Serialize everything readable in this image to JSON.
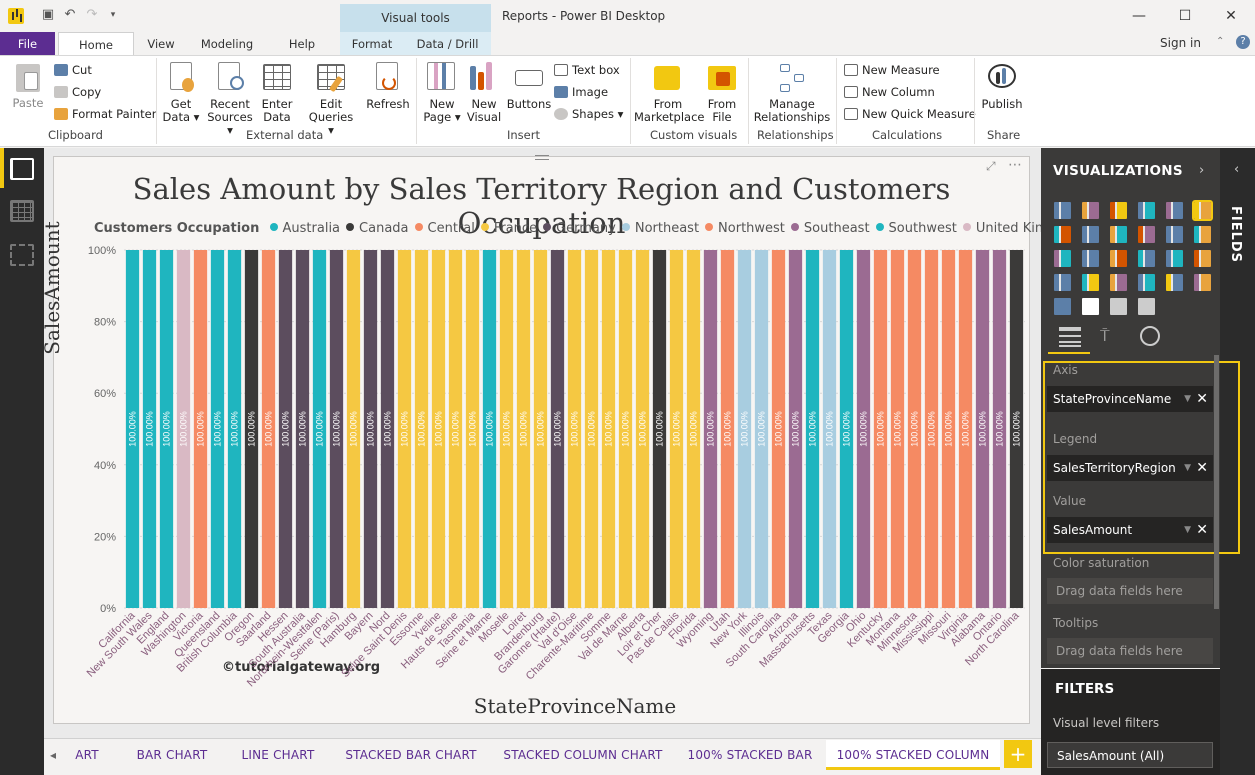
{
  "window": {
    "title": "Reports - Power BI Desktop",
    "context_tab": "Visual tools",
    "sign_in": "Sign in",
    "minimize": "—",
    "maximize": "☐",
    "close": "✕"
  },
  "ribbon_tabs": [
    "File",
    "Home",
    "View",
    "Modeling",
    "Help",
    "Format",
    "Data / Drill"
  ],
  "ribbon": {
    "clipboard": {
      "paste": "Paste",
      "cut": "Cut",
      "copy": "Copy",
      "format_painter": "Format Painter",
      "group": "Clipboard"
    },
    "external": {
      "get_data": [
        "Get",
        "Data ▾"
      ],
      "recent_sources": [
        "Recent",
        "Sources ▾"
      ],
      "enter_data": [
        "Enter",
        "Data"
      ],
      "edit_queries": [
        "Edit",
        "Queries ▾"
      ],
      "refresh": "Refresh",
      "group": "External data"
    },
    "insert": {
      "new_page": [
        "New",
        "Page ▾"
      ],
      "new_visual": [
        "New",
        "Visual"
      ],
      "buttons": "Buttons",
      "text_box": "Text box",
      "image": "Image",
      "shapes": "Shapes ▾",
      "group": "Insert"
    },
    "custom": {
      "marketplace": [
        "From",
        "Marketplace"
      ],
      "file": [
        "From",
        "File"
      ],
      "group": "Custom visuals"
    },
    "relationships": {
      "manage": [
        "Manage",
        "Relationships"
      ],
      "group": "Relationships"
    },
    "calculations": {
      "new_measure": "New Measure",
      "new_column": "New Column",
      "new_quick_measure": "New Quick Measure",
      "group": "Calculations"
    },
    "share": {
      "publish": "Publish",
      "group": "Share"
    }
  },
  "visual": {
    "title": "Sales Amount by Sales Territory Region and Customers Occupation",
    "legend_title": "Customers Occupation",
    "legend": [
      {
        "name": "Australia",
        "color": "#1fb5bf"
      },
      {
        "name": "Canada",
        "color": "#3b3a39"
      },
      {
        "name": "Central",
        "color": "#f58a63"
      },
      {
        "name": "France",
        "color": "#f5c842"
      },
      {
        "name": "Germany",
        "color": "#5c4d5e"
      },
      {
        "name": "Northeast",
        "color": "#a8cde0"
      },
      {
        "name": "Northwest",
        "color": "#f58a63"
      },
      {
        "name": "Southeast",
        "color": "#9b6b92"
      },
      {
        "name": "Southwest",
        "color": "#1fb5bf"
      },
      {
        "name": "United Kingdom",
        "color": "#d9b9c4"
      }
    ],
    "y_axis_title": "SalesAmount",
    "x_axis_title": "StateProvinceName",
    "watermark": "©tutorialgateway.org"
  },
  "chart_data": {
    "type": "bar",
    "stacked_percent": true,
    "y_ticks": [
      "0%",
      "20%",
      "40%",
      "60%",
      "80%",
      "100%"
    ],
    "ylim": [
      0,
      100
    ],
    "categories": [
      "California",
      "New South Wales",
      "England",
      "Washington",
      "Victoria",
      "Queensland",
      "British Columbia",
      "Oregon",
      "Saarland",
      "Hessen",
      "South Australia",
      "Nordrhein-Westfalen",
      "Seine (Paris)",
      "Hamburg",
      "Bayern",
      "Nord",
      "Seine Saint Denis",
      "Essonne",
      "Yveline",
      "Hauts de Seine",
      "Tasmania",
      "Seine et Marne",
      "Moselle",
      "Loiret",
      "Brandenburg",
      "Garonne (Haute)",
      "Val d'Oise",
      "Charente-Maritime",
      "Somme",
      "Val de Marne",
      "Alberta",
      "Loir et Cher",
      "Pas de Calais",
      "Florida",
      "Wyoming",
      "Utah",
      "New York",
      "Illinois",
      "South Carolina",
      "Arizona",
      "Massachusetts",
      "Texas",
      "Georgia",
      "Ohio",
      "Kentucky",
      "Montana",
      "Minnesota",
      "Mississippi",
      "Missouri",
      "Virginia",
      "Alabama",
      "Ontario",
      "North Carolina"
    ],
    "regions": [
      "Southwest",
      "Australia",
      "Australia",
      "United Kingdom",
      "Northwest",
      "Australia",
      "Australia",
      "Canada",
      "Northwest",
      "Germany",
      "Germany",
      "Australia",
      "Germany",
      "France",
      "Germany",
      "Germany",
      "France",
      "France",
      "France",
      "France",
      "France",
      "Australia",
      "France",
      "France",
      "France",
      "Germany",
      "France",
      "France",
      "France",
      "France",
      "France",
      "Canada",
      "France",
      "France",
      "Southeast",
      "Northwest",
      "Northeast",
      "Northeast",
      "Central",
      "Southeast",
      "Southwest",
      "Northeast",
      "Southwest",
      "Southeast",
      "Central",
      "Central",
      "Northwest",
      "Central",
      "Central",
      "Central",
      "Southeast",
      "Southeast",
      "Canada",
      "Southeast"
    ],
    "values": [
      100,
      100,
      100,
      100,
      100,
      100,
      100,
      100,
      100,
      100,
      100,
      100,
      100,
      100,
      100,
      100,
      100,
      100,
      100,
      100,
      100,
      100,
      100,
      100,
      100,
      100,
      100,
      100,
      100,
      100,
      100,
      100,
      100,
      100,
      100,
      100,
      100,
      100,
      100,
      100,
      100,
      100,
      100,
      100,
      100,
      100,
      100,
      100,
      100,
      100,
      100,
      100,
      100,
      100
    ],
    "data_label": "100.00%"
  },
  "viz_pane": {
    "header": "VISUALIZATIONS",
    "fields_tab": "FIELDS",
    "axis_label": "Axis",
    "axis_value": "StateProvinceName",
    "legend_label": "Legend",
    "legend_value": "SalesTerritoryRegion",
    "value_label": "Value",
    "value_value": "SalesAmount",
    "color_sat_label": "Color saturation",
    "tooltips_label": "Tooltips",
    "drop_placeholder": "Drag data fields here",
    "filters_header": "FILTERS",
    "visual_level_filters": "Visual level filters",
    "filter_item": "SalesAmount (All)"
  },
  "page_tabs": [
    "ART",
    "BAR CHART",
    "LINE CHART",
    "STACKED BAR CHART",
    "STACKED COLUMN CHART",
    "100% STACKED BAR",
    "100% STACKED COLUMN"
  ],
  "add_page": "+"
}
